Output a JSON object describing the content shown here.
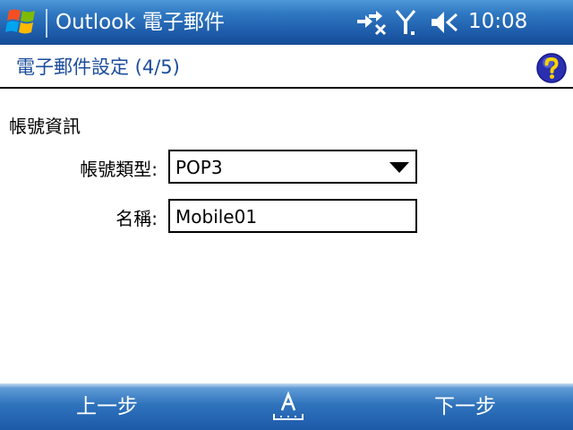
{
  "title_bar": {
    "app_title": "Outlook 電子郵件",
    "clock": "10:08",
    "icons": [
      "windows-start-icon",
      "connectivity-icon",
      "signal-icon",
      "speaker-muted-icon"
    ]
  },
  "header": {
    "title": "電子郵件設定 (4/5)",
    "help_icon": "help-icon"
  },
  "form": {
    "section_label": "帳號資訊",
    "account_type": {
      "label": "帳號類型:",
      "value": "POP3"
    },
    "name": {
      "label": "名稱:",
      "value": "Mobile01"
    }
  },
  "menu_bar": {
    "left_label": "上一步",
    "right_label": "下一步",
    "center_icon": "input-panel-icon"
  },
  "colors": {
    "title_bar": "#1d5aa8",
    "header_text": "#1c4d9c",
    "help_icon_bg": "#2a2fb0"
  }
}
